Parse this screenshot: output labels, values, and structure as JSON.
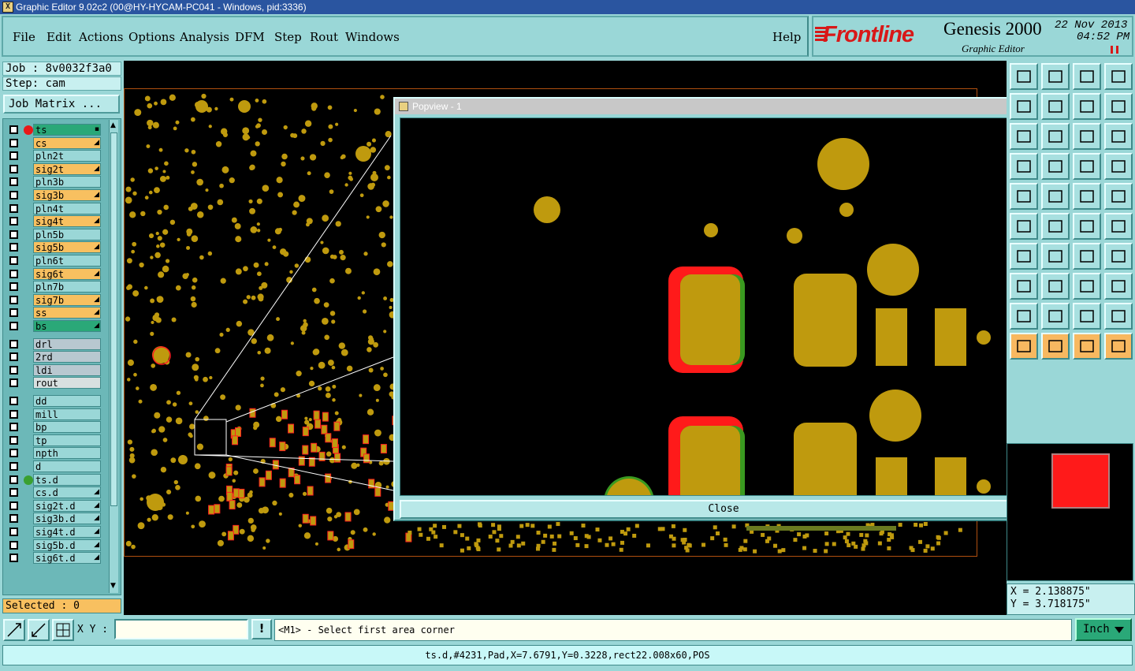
{
  "window": {
    "title": "Graphic Editor 9.02c2 (00@HY-HYCAM-PC041 - Windows, pid:3336)"
  },
  "menu": [
    "File",
    "Edit",
    "Actions",
    "Options",
    "Analysis",
    "DFM",
    "Step",
    "Rout",
    "Windows",
    "Help"
  ],
  "brand": {
    "logo_text": "Frontline",
    "product": "Genesis 2000",
    "subtitle": "Graphic Editor",
    "date": "22 Nov 2013",
    "time": "04:52 PM"
  },
  "job": {
    "job_label": "Job : 8v0032f3a0",
    "step_label": "Step: cam",
    "matrix_button": "Job Matrix ..."
  },
  "layers": [
    {
      "name": "ts",
      "color": "#2aa878",
      "dot": "#e81818",
      "arrow": "▪"
    },
    {
      "name": "cs",
      "color": "#f8c060",
      "arrow": "◢"
    },
    {
      "name": "pln2t",
      "color": "#9ad7d7"
    },
    {
      "name": "sig2t",
      "color": "#f8c060",
      "arrow": "◢"
    },
    {
      "name": "pln3b",
      "color": "#9ad7d7"
    },
    {
      "name": "sig3b",
      "color": "#f8c060",
      "arrow": "◢"
    },
    {
      "name": "pln4t",
      "color": "#9ad7d7"
    },
    {
      "name": "sig4t",
      "color": "#f8c060",
      "arrow": "◢"
    },
    {
      "name": "pln5b",
      "color": "#9ad7d7"
    },
    {
      "name": "sig5b",
      "color": "#f8c060",
      "arrow": "◢"
    },
    {
      "name": "pln6t",
      "color": "#9ad7d7"
    },
    {
      "name": "sig6t",
      "color": "#f8c060",
      "arrow": "◢"
    },
    {
      "name": "pln7b",
      "color": "#9ad7d7"
    },
    {
      "name": "sig7b",
      "color": "#f8c060",
      "arrow": "◢"
    },
    {
      "name": "ss",
      "color": "#f8c060",
      "arrow": "◢"
    },
    {
      "name": "bs",
      "color": "#2aa878",
      "arrow": "◢"
    },
    {
      "name": "drl",
      "color": "#b8c8d0"
    },
    {
      "name": "2rd",
      "color": "#b8c8d0"
    },
    {
      "name": "ldi",
      "color": "#b8c8d0"
    },
    {
      "name": "rout",
      "color": "#d8e0e0"
    },
    {
      "name": "dd",
      "color": "#9ad7d7"
    },
    {
      "name": "mill",
      "color": "#9ad7d7"
    },
    {
      "name": "bp",
      "color": "#9ad7d7"
    },
    {
      "name": "tp",
      "color": "#9ad7d7"
    },
    {
      "name": "npth",
      "color": "#9ad7d7"
    },
    {
      "name": "d",
      "color": "#9ad7d7"
    },
    {
      "name": "ts.d",
      "color": "#9ad7d7",
      "dot": "#3aa030"
    },
    {
      "name": "cs.d",
      "color": "#9ad7d7",
      "arrow": "◢"
    },
    {
      "name": "sig2t.d",
      "color": "#9ad7d7",
      "arrow": "◢"
    },
    {
      "name": "sig3b.d",
      "color": "#9ad7d7",
      "arrow": "◢"
    },
    {
      "name": "sig4t.d",
      "color": "#9ad7d7",
      "arrow": "◢"
    },
    {
      "name": "sig5b.d",
      "color": "#9ad7d7",
      "arrow": "◢"
    },
    {
      "name": "sig6t.d",
      "color": "#9ad7d7",
      "arrow": "◢"
    }
  ],
  "selected": "Selected : 0",
  "popview": {
    "title": "Popview - 1",
    "close_label": "Close"
  },
  "coords": {
    "x": "X = 2.138875\"",
    "y": "Y = 3.718175\""
  },
  "bottom": {
    "xy_label": "X Y :",
    "xy_value": "",
    "warn": "!",
    "prompt": "<M1> - Select first area corner",
    "units": "Inch"
  },
  "status": "ts.d,#4231,Pad,X=7.6791,Y=0.3228,rect22.008x60,POS",
  "colors": {
    "pad": "#bf9a0e",
    "highlight": "#ff1a1a",
    "green": "#3a9a20",
    "panel": "#9ad7d7"
  }
}
